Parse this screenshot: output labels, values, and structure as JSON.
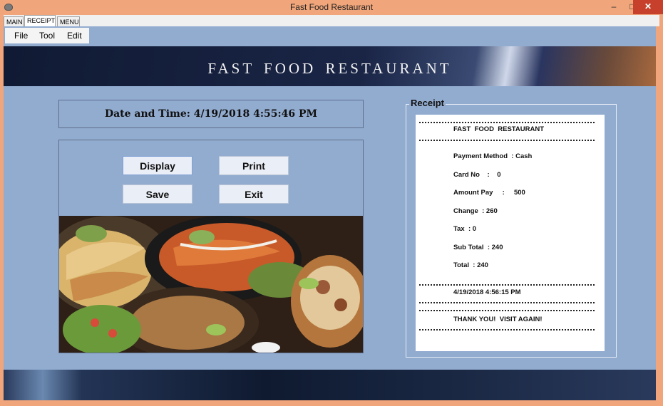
{
  "window": {
    "title": "Fast Food Restaurant",
    "controls": {
      "minimize": "–",
      "maximize": "□",
      "close": "✕"
    }
  },
  "tabs": [
    "MAIN",
    "RECEIPT",
    "MENU"
  ],
  "menu": {
    "file": "File",
    "tool": "Tool",
    "edit": "Edit"
  },
  "banner": {
    "text": "FAST  FOOD RESTAURANT"
  },
  "datetime": {
    "text": "Date and Time: 4/19/2018 4:55:46 PM"
  },
  "buttons": {
    "display": "Display",
    "print": "Print",
    "save": "Save",
    "exit": "Exit"
  },
  "receipt": {
    "legend": "Receipt",
    "header": "FAST  FOOD  RESTAURANT",
    "payment_method": "Payment Method  : Cash",
    "card_no": "Card No    :    0",
    "amount_pay": "Amount Pay     :     500",
    "change": "Change  : 260",
    "tax": "Tax  : 0",
    "sub_total": "Sub Total  : 240",
    "total": "Total  : 240",
    "timestamp": "4/19/2018 4:56:15 PM",
    "footer": "THANK YOU!  VISIT AGAIN!"
  }
}
